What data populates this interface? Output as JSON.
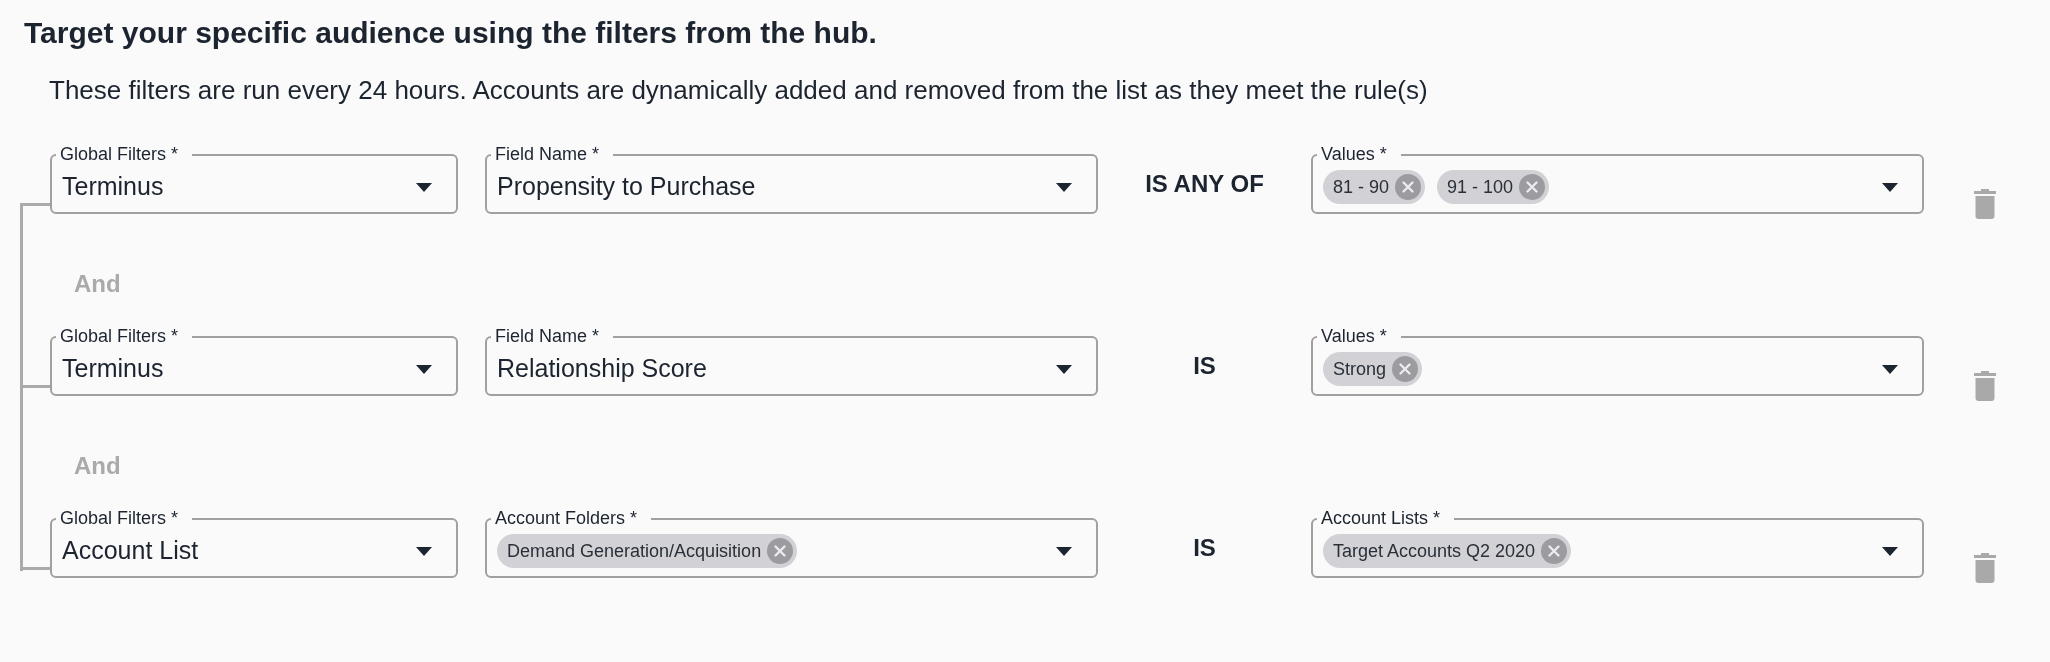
{
  "heading": "Target your specific audience using the filters from the hub.",
  "description": "These filters are run every 24 hours. Accounts are dynamically added and removed from the list as they meet the rule(s)",
  "rules": [
    {
      "source": {
        "label": "Global Filters *",
        "kind": "text",
        "value": "Terminus"
      },
      "field": {
        "label": "Field Name *",
        "kind": "text",
        "value": "Propensity to Purchase"
      },
      "operator": "IS ANY OF",
      "values": {
        "label": "Values *",
        "kind": "chips",
        "chips": [
          "81 - 90",
          "91 - 100"
        ]
      }
    },
    {
      "conjunction": "And",
      "source": {
        "label": "Global Filters *",
        "kind": "text",
        "value": "Terminus"
      },
      "field": {
        "label": "Field Name *",
        "kind": "text",
        "value": "Relationship Score"
      },
      "operator": "IS",
      "values": {
        "label": "Values *",
        "kind": "chips",
        "chips": [
          "Strong"
        ]
      }
    },
    {
      "conjunction": "And",
      "source": {
        "label": "Global Filters *",
        "kind": "text",
        "value": "Account List"
      },
      "field": {
        "label": "Account Folders *",
        "kind": "chips",
        "chips": [
          "Demand Generation/Acquisition"
        ]
      },
      "operator": "IS",
      "values": {
        "label": "Account Lists *",
        "kind": "chips",
        "chips": [
          "Target Accounts Q2 2020"
        ]
      }
    }
  ]
}
